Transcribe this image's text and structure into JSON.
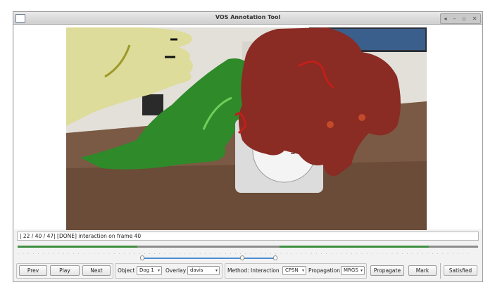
{
  "window": {
    "title": "VOS Annotation Tool",
    "controls": [
      "◂",
      "–",
      "▫",
      "✕"
    ]
  },
  "status": {
    "text": "| 22 /  40 /  47| [DONE] interaction on frame 40"
  },
  "timeline": {
    "ticks": "· · · · · · · · · · · · · · · · · · · · · · · · · · · · · · · · · · · · · · · · · · · · · · · · · · · · · · · · · · · · · · · · · · · · · · · · · · · · · · · · · · · · · · · · · ·"
  },
  "toolbar": {
    "prev_label": "Prev",
    "play_label": "Play",
    "next_label": "Next",
    "object_label": "Object",
    "object_value": "Dog 1",
    "overlay_label": "Overlay",
    "overlay_value": "davis",
    "method_label": "Method:",
    "interaction_label": "Interaction",
    "interaction_value": "CPSN",
    "propagation_label": "Propagation",
    "propagation_value": "MRGS",
    "propagate_label": "Propagate",
    "mark_label": "Mark",
    "satisfied_label": "Satisfied"
  }
}
